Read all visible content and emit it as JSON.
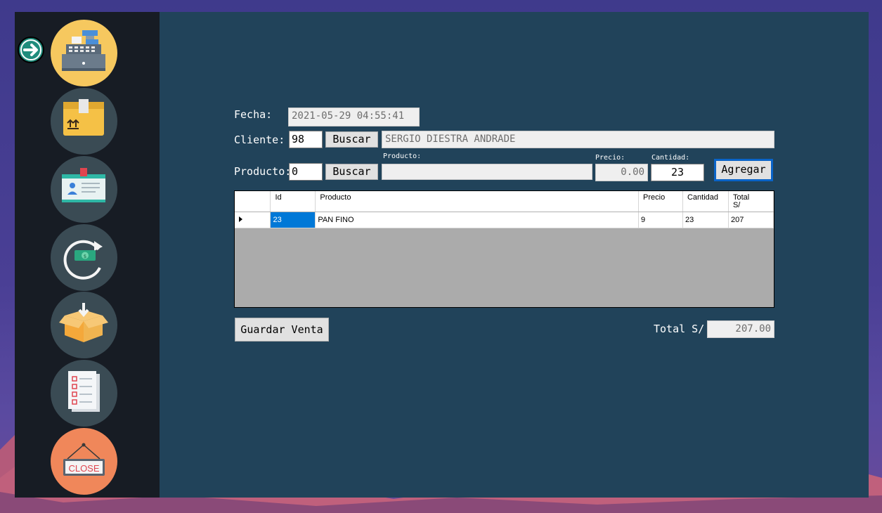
{
  "sidebar": {
    "items": [
      {
        "id": "ventas",
        "icon": "cash-register-icon"
      },
      {
        "id": "productos",
        "icon": "product-box-icon"
      },
      {
        "id": "clientes",
        "icon": "id-card-icon"
      },
      {
        "id": "devoluciones",
        "icon": "money-refresh-icon"
      },
      {
        "id": "compras",
        "icon": "box-in-icon"
      },
      {
        "id": "reportes",
        "icon": "checklist-icon"
      },
      {
        "id": "cerrar",
        "icon": "close-sign-icon",
        "label": "CLOSE"
      }
    ],
    "indicator_icon": "arrow-right-circle-icon"
  },
  "form": {
    "fecha_label": "Fecha:",
    "fecha_value": "2021-05-29 04:55:41",
    "cliente_label": "Cliente:",
    "cliente_id": "98",
    "buscar_label": "Buscar",
    "cliente_nombre": "SERGIO DIESTRA ANDRADE",
    "producto_label": "Producto:",
    "producto_id": "0",
    "producto_small_label": "Producto:",
    "producto_nombre": "",
    "precio_label": "Precio:",
    "precio_value": "0.00",
    "cantidad_label": "Cantidad:",
    "cantidad_value": "23",
    "agregar_label": "Agregar"
  },
  "grid": {
    "columns": [
      "",
      "Id",
      "Producto",
      "Precio",
      "Cantidad",
      "Total S/"
    ],
    "rows": [
      {
        "id": "23",
        "producto": "PAN FINO",
        "precio": "9",
        "cantidad": "23",
        "total": "207"
      }
    ]
  },
  "footer": {
    "guardar_label": "Guardar Venta",
    "total_label": "Total S/",
    "total_value": "207.00"
  },
  "colors": {
    "panel": "#21435a",
    "sidebar": "#171c24",
    "active_nav": "#f6c85f",
    "close_nav": "#f0875a",
    "selection": "#0078d7"
  }
}
